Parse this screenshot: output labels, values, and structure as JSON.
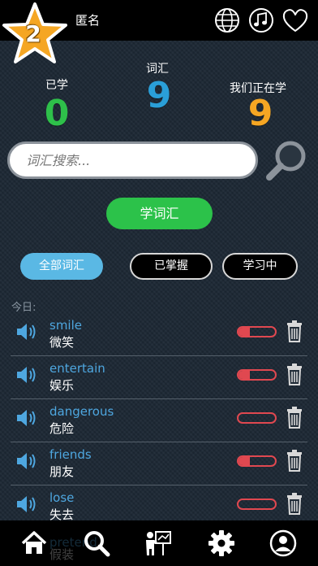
{
  "header": {
    "level": "2",
    "username": "匿名",
    "icons": [
      "globe-icon",
      "music-note-icon",
      "heart-icon"
    ]
  },
  "stats": {
    "learned": {
      "label": "已学",
      "value": "0",
      "color": "#2ec04a"
    },
    "vocab": {
      "label": "词汇",
      "value": "9",
      "color": "#2a9fd8"
    },
    "learning": {
      "label": "我们正在学",
      "value": "9",
      "color": "#f5a623"
    }
  },
  "search": {
    "placeholder": "词汇搜索..."
  },
  "learn_button": "学词汇",
  "filters": [
    {
      "label": "全部词汇",
      "active": true
    },
    {
      "label": "已掌握",
      "active": false
    },
    {
      "label": "学习中",
      "active": false
    }
  ],
  "section_label": "今日:",
  "words": [
    {
      "en": "smile",
      "zh": "微笑",
      "progress": 0.3
    },
    {
      "en": "entertain",
      "zh": "娱乐",
      "progress": 0.3
    },
    {
      "en": "dangerous",
      "zh": "危险",
      "progress": 0
    },
    {
      "en": "friends",
      "zh": "朋友",
      "progress": 0.3
    },
    {
      "en": "lose",
      "zh": "失去",
      "progress": 0
    }
  ],
  "ghost_word": {
    "en": "pretend",
    "zh": "假装"
  },
  "nav": [
    "home-icon",
    "search-icon",
    "teacher-board-icon",
    "settings-gear-icon",
    "profile-icon"
  ],
  "colors": {
    "accent_blue": "#5ab8e4",
    "green": "#2cc24a",
    "progress_red": "#e04850"
  }
}
